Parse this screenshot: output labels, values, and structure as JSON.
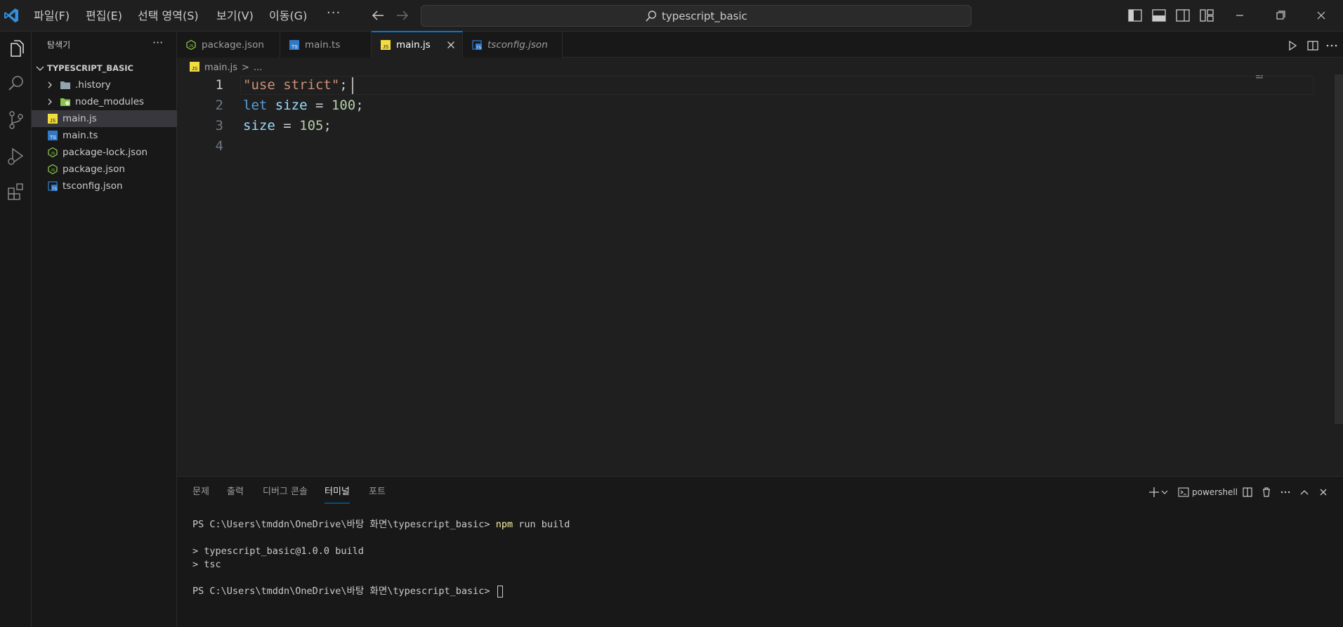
{
  "titlebar": {
    "menu": [
      "파일(F)",
      "편집(E)",
      "선택 영역(S)",
      "보기(V)",
      "이동(G)"
    ],
    "menu_more": "···",
    "search_text": "typescript_basic"
  },
  "sidebar": {
    "title": "탐색기",
    "more": "···",
    "folder": "TYPESCRIPT_BASIC",
    "items": [
      {
        "label": ".history",
        "type": "folder"
      },
      {
        "label": "node_modules",
        "type": "folder"
      },
      {
        "label": "main.js",
        "type": "js"
      },
      {
        "label": "main.ts",
        "type": "ts"
      },
      {
        "label": "package-lock.json",
        "type": "json-node"
      },
      {
        "label": "package.json",
        "type": "json-node"
      },
      {
        "label": "tsconfig.json",
        "type": "tsconfig"
      }
    ]
  },
  "tabs": [
    {
      "label": "package.json",
      "type": "json-node"
    },
    {
      "label": "main.ts",
      "type": "ts"
    },
    {
      "label": "main.js",
      "type": "js",
      "active": true
    },
    {
      "label": "tsconfig.json",
      "type": "tsconfig",
      "preview": true
    }
  ],
  "breadcrumb": {
    "file": "main.js",
    "separator": ">",
    "rest": "..."
  },
  "editor": {
    "line_numbers": [
      "1",
      "2",
      "3",
      "4"
    ],
    "line1": {
      "str": "\"use strict\"",
      "semi": ";"
    },
    "line2": {
      "kw": "let",
      "var": "size",
      "eq": "=",
      "num": "100",
      "semi": ";"
    },
    "line3": {
      "var": "size",
      "eq": "=",
      "num": "105",
      "semi": ";"
    }
  },
  "panel": {
    "tabs": [
      "문제",
      "출력",
      "디버그 콘솔",
      "터미널",
      "포트"
    ],
    "active_tab": "터미널",
    "shell": "powershell",
    "terminal": {
      "prompt1": "PS C:\\Users\\tmddn\\OneDrive\\바탕 화면\\typescript_basic> ",
      "cmd1": "npm",
      "cmd1_rest": " run build",
      "out1": "> typescript_basic@1.0.0 build",
      "out2": "> tsc",
      "prompt2": "PS C:\\Users\\tmddn\\OneDrive\\바탕 화면\\typescript_basic> "
    }
  },
  "colors": {
    "accent": "#0078d4",
    "js_icon": "#f1dd3f",
    "ts_icon": "#3178c6",
    "node_icon": "#8bc34a"
  }
}
